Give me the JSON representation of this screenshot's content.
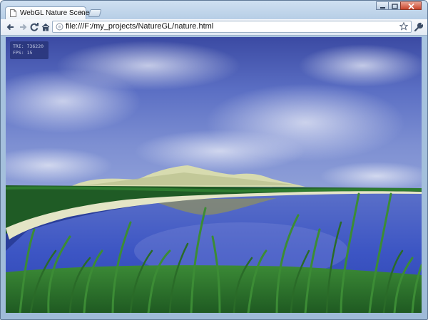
{
  "window": {
    "tab_title": "WebGL Nature Scene",
    "tab_close": "×",
    "controls": [
      "minimize-icon",
      "maximize-icon",
      "close-icon"
    ]
  },
  "toolbar": {
    "back_icon": "back-arrow-icon",
    "forward_icon": "forward-arrow-icon",
    "reload_icon": "reload-icon",
    "home_icon": "home-icon",
    "url": "file:///F:/my_projects/NatureGL/nature.html",
    "star_icon": "star-icon",
    "menu_icon": "wrench-icon"
  },
  "scene": {
    "stats": {
      "tri_line": "TRI: 736220",
      "fps_line": "FPS: 15"
    }
  },
  "colors": {
    "sky_top": "#2f3f95",
    "sky_mid": "#5a6cc0",
    "water": "#3a52c4",
    "grass": "#2f7a2a",
    "hills": "#d9dcb0"
  }
}
